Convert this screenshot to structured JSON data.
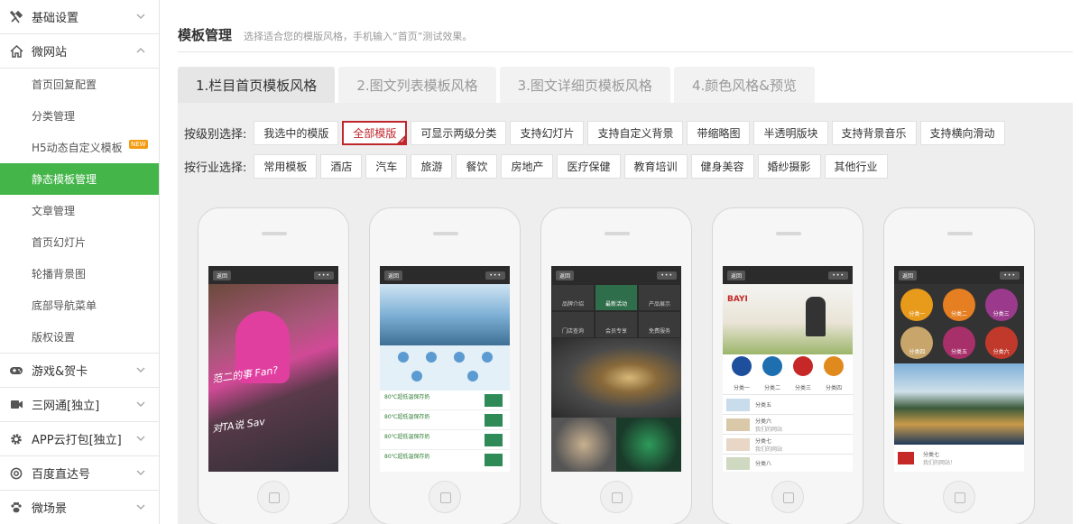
{
  "sidebar": {
    "groups": [
      {
        "label": "基础设置",
        "icon": "tools-icon"
      },
      {
        "label": "微网站",
        "icon": "home-icon"
      },
      {
        "label": "游戏&贺卡",
        "icon": "gamepad-icon"
      },
      {
        "label": "三网通[独立]",
        "icon": "video-icon"
      },
      {
        "label": "APP云打包[独立]",
        "icon": "gear-icon"
      },
      {
        "label": "百度直达号",
        "icon": "at-icon"
      },
      {
        "label": "微场景",
        "icon": "paw-icon"
      }
    ],
    "sub_items": [
      "首页回复配置",
      "分类管理",
      "H5动态自定义模板",
      "静态模板管理",
      "文章管理",
      "首页幻灯片",
      "轮播背景图",
      "底部导航菜单",
      "版权设置"
    ],
    "new_badge": "NEW",
    "accent_color": "#44b549"
  },
  "header": {
    "title": "模板管理",
    "subtitle": "选择适合您的模版风格，手机输入“首页”测试效果。"
  },
  "tabs": [
    "1.栏目首页模板风格",
    "2.图文列表模板风格",
    "3.图文详细页模板风格",
    "4.颜色风格&预览"
  ],
  "filters": {
    "level_label": "按级别选择:",
    "level_options": [
      "我选中的模版",
      "全部模版",
      "可显示两级分类",
      "支持幻灯片",
      "支持自定义背景",
      "带缩略图",
      "半透明版块",
      "支持背景音乐",
      "支持横向滑动"
    ],
    "selected_level": "全部模版",
    "industry_label": "按行业选择:",
    "industry_options": [
      "常用模板",
      "酒店",
      "汽车",
      "旅游",
      "餐饮",
      "房地产",
      "医疗保健",
      "教育培训",
      "健身美容",
      "婚纱摄影",
      "其他行业"
    ],
    "selected_color": "#c0262c"
  },
  "phones": {
    "back_label": "返回",
    "more_label": "•••",
    "p1": {
      "overlay1": "范二的事 Fan?",
      "overlay2": "对TA说 Sav"
    },
    "p2": {
      "list_title": "80℃超低温保存奶"
    },
    "p3": {
      "menu": [
        "品牌介绍",
        "最新活动",
        "产品展示",
        "门店查询",
        "会员专享",
        "免费服务"
      ]
    },
    "p4": {
      "brand": "BAYI",
      "list": [
        "分类五",
        "分类六",
        "分类七",
        "分类八"
      ],
      "list_sub": [
        "",
        "我们的网站",
        "我们的网站",
        ""
      ],
      "icons": [
        "分类一",
        "分类二",
        "分类三",
        "分类四"
      ]
    },
    "p5": {
      "tiles": [
        "分类一",
        "分类二",
        "分类三",
        "分类四",
        "分类五",
        "分类六"
      ],
      "bottom_title": "分类七",
      "bottom_sub": "我们的网站！"
    }
  }
}
